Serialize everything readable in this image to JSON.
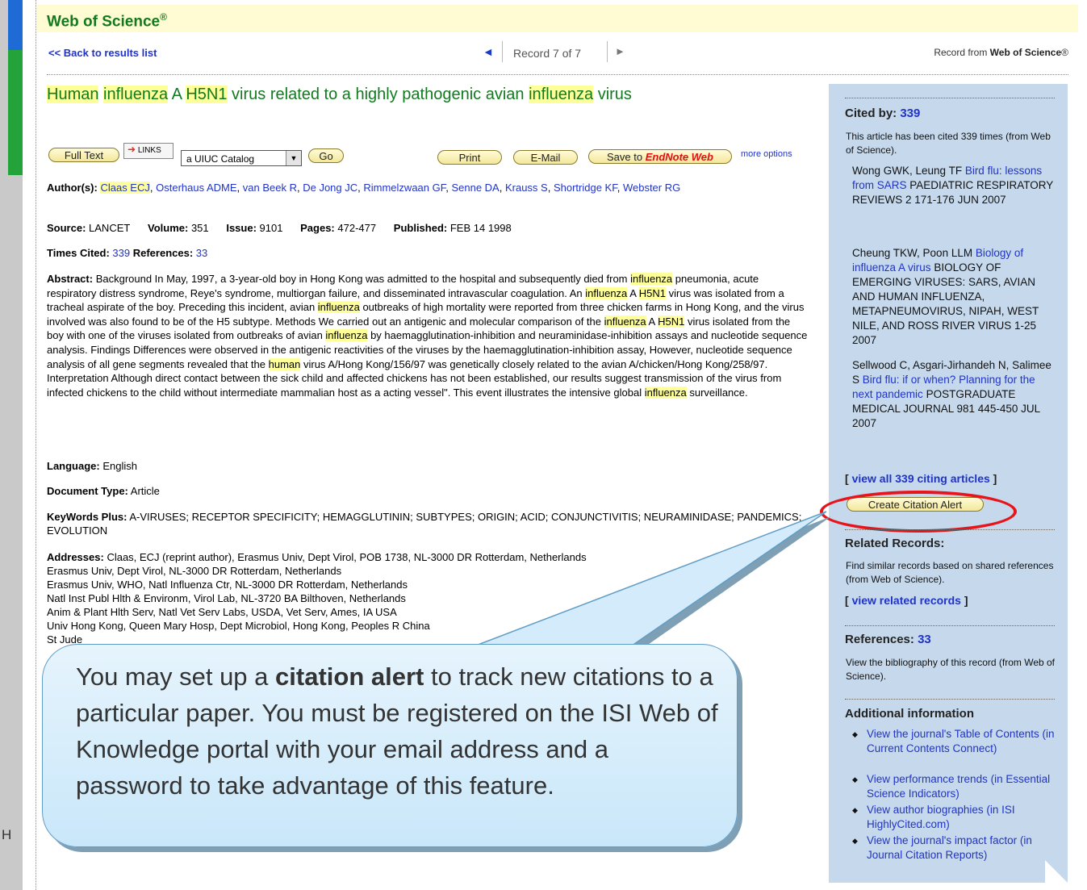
{
  "header": {
    "brand": "Web of Science",
    "brand_mark": "®"
  },
  "nav": {
    "back": "<< Back to results list",
    "prev_icon": "◄",
    "record": "Record 7 of 7",
    "next_icon": "►",
    "record_from_prefix": "Record from ",
    "record_from_brand": "Web of Science",
    "record_from_mark": "®"
  },
  "title": {
    "parts": [
      "Human",
      " ",
      "influenza",
      " A ",
      "H5N1",
      " virus related to a highly pathogenic avian ",
      "influenza",
      " virus"
    ]
  },
  "toolbar": {
    "full_text": "Full Text",
    "links": "LINKS",
    "catalog": "a UIUC Catalog",
    "go": "Go",
    "print": "Print",
    "email": "E-Mail",
    "save_prefix": "Save to ",
    "save_brand": "EndNote Web",
    "more_options": "more options"
  },
  "record": {
    "authors_label": "Author(s):",
    "authors": [
      "Claas ECJ",
      "Osterhaus ADME",
      "van Beek R",
      "De Jong JC",
      "Rimmelzwaan GF",
      "Senne DA",
      "Krauss S",
      "Shortridge KF",
      "Webster RG"
    ],
    "source_label": "Source:",
    "source": "LANCET",
    "volume_label": "Volume:",
    "volume": "351",
    "issue_label": "Issue:",
    "issue": "9101",
    "pages_label": "Pages:",
    "pages": "472-477",
    "published_label": "Published:",
    "published": "FEB 14 1998",
    "times_cited_label": "Times Cited:",
    "times_cited": "339",
    "references_label": "References:",
    "references": "33",
    "abstract_label": "Abstract:",
    "language_label": "Language:",
    "language": "English",
    "doctype_label": "Document Type:",
    "doctype": "Article",
    "keywords_label": "KeyWords Plus:",
    "keywords": "A-VIRUSES; RECEPTOR SPECIFICITY; HEMAGGLUTININ; SUBTYPES; ORIGIN; ACID; CONJUNCTIVITIS; NEURAMINIDASE; PANDEMICS; EVOLUTION",
    "addresses_label": "Addresses:",
    "addresses": [
      "Claas, ECJ (reprint author), Erasmus Univ, Dept Virol, POB 1738, NL-3000 DR Rotterdam, Netherlands",
      "Erasmus Univ, Dept Virol, NL-3000 DR Rotterdam, Netherlands",
      "Erasmus Univ, WHO, Natl Influenza Ctr, NL-3000 DR Rotterdam, Netherlands",
      "Natl Inst Publ Hlth & Environm, Virol Lab, NL-3720 BA Bilthoven, Netherlands",
      "Anim & Plant Hlth Serv, Natl Vet Serv Labs, USDA, Vet Serv, Ames, IA USA",
      "Univ Hong Kong, Queen Mary Hosp, Dept Microbiol, Hong Kong, Peoples R China",
      "St Jude"
    ]
  },
  "abstract_segments": [
    {
      "t": " Background In May, 1997, a 3-year-old boy in Hong Kong was admitted to the hospital and subsequently died from "
    },
    {
      "t": "influenza",
      "h": true
    },
    {
      "t": " pneumonia, acute respiratory distress syndrome, Reye's syndrome, multiorgan failure, and disseminated intravascular coagulation. An "
    },
    {
      "t": "influenza",
      "h": true
    },
    {
      "t": " A "
    },
    {
      "t": "H5N1",
      "h": true
    },
    {
      "t": " virus was isolated from a tracheal aspirate of the boy. Preceding this incident, avian "
    },
    {
      "t": "influenza",
      "h": true
    },
    {
      "t": " outbreaks of high mortality were reported from three chicken farms in Hong Kong, and the virus involved was also found to be of the H5 subtype. Methods We carried out an antigenic and molecular comparison of the "
    },
    {
      "t": "influenza",
      "h": true
    },
    {
      "t": " A "
    },
    {
      "t": "H5N1",
      "h": true
    },
    {
      "t": " virus isolated from the boy with one of the viruses isolated from outbreaks of avian "
    },
    {
      "t": "influenza",
      "h": true
    },
    {
      "t": " by haemagglutination-inhibition and neuraminidase-inhibition assays and nucleotide sequence analysis. Findings Differences were observed in the antigenic reactivities of the viruses by the haemagglutination-inhibition assay, However, nucleotide sequence analysis of all gene segments revealed that the "
    },
    {
      "t": "human",
      "h": true
    },
    {
      "t": " virus A/Hong Kong/156/97 was genetically closely related to the avian A/chicken/Hong Kong/258/97. Interpretation Although direct contact between the sick child and affected chickens has not been established, our results suggest transmission of the virus from infected chickens to the child without intermediate mammalian host as a acting vessel\". This event illustrates the intensive global "
    },
    {
      "t": "influenza",
      "h": true
    },
    {
      "t": " surveillance."
    }
  ],
  "sidebar": {
    "cited_by_label": "Cited by:",
    "cited_by_count": "339",
    "cited_by_desc": "This article has been cited 339 times (from Web of Science).",
    "citing": [
      {
        "authors": "Wong GWK, Leung TF ",
        "title": "Bird flu: lessons from SARS",
        "rest": " PAEDIATRIC RESPIRATORY REVIEWS 2 171-176 JUN 2007"
      },
      {
        "authors": "Cheung TKW, Poon LLM ",
        "title": "Biology of influenza A virus",
        "rest": " BIOLOGY OF EMERGING VIRUSES: SARS, AVIAN AND HUMAN INFLUENZA, METAPNEUMOVIRUS, NIPAH, WEST NILE, AND ROSS RIVER VIRUS 1-25 2007"
      },
      {
        "authors": "Sellwood C, Asgari-Jirhandeh N, Salimee S ",
        "title": "Bird flu: if or when? Planning for the next pandemic",
        "rest": " POSTGRADUATE MEDICAL JOURNAL 981 445-450 JUL 2007"
      }
    ],
    "view_all": "view all 339 citing articles",
    "create_alert": "Create Citation Alert",
    "related_heading": "Related Records:",
    "related_desc": "Find similar records based on shared references (from Web of Science).",
    "view_related": "view related records",
    "references_label": "References:",
    "references_count": "33",
    "references_desc": "View the bibliography of this record (from Web of Science).",
    "additional_heading": "Additional information",
    "additional": [
      "View the journal's Table of Contents (in Current Contents Connect)",
      "View performance trends (in Essential Science Indicators)",
      "View author biographies (in ISI HighlyCited.com)",
      "View the journal's impact factor (in Journal Citation Reports)"
    ]
  },
  "callout": {
    "before": "You may set up a ",
    "bold": "citation alert",
    "after": " to track new citations to a particular paper.  You must be registered on the ISI Web of Knowledge portal with your email address and a password to take advantage of this feature."
  },
  "stray_glyph": "H"
}
